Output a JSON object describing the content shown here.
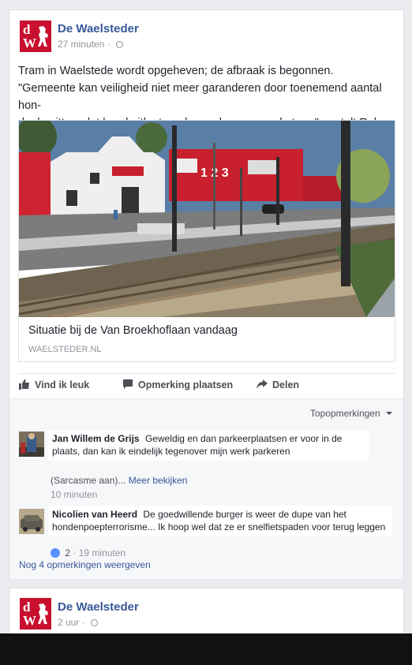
{
  "post": {
    "page_name": "De Waelsteder",
    "time": "27 minuten",
    "text_line1": "Tram in Waelstede wordt opgeheven; de afbraak is begonnen.",
    "text_line2": "\"Gemeente kan veiligheid niet meer garanderen door toenemend aantal hon-",
    "text_line3": "denbezitters dat hond uitlaat op de grasbanen van de tram\", vertelt Rob.",
    "link_title": "Situatie bij de Van Broekhoflaan vandaag",
    "link_domain": "WAELSTEDER.NL",
    "building_sign": "1 2 3"
  },
  "logo": {
    "line1": "d",
    "line2": "W"
  },
  "actions": {
    "like": "Vind ik leuk",
    "comment": "Opmerking plaatsen",
    "share": "Delen"
  },
  "comments": {
    "sort_label": "Topopmerkingen",
    "items": [
      {
        "author": "Jan Willem de Grijs",
        "text_a": "Geweldig en dan parkeerplaatsen er voor in de",
        "text_b": "plaats, dan kan ik eindelijk tegenover mijn werk parkeren",
        "extra": "(Sarcasme aan)...",
        "see_more": "Meer bekijken",
        "time": "10 minuten"
      },
      {
        "author": "Nicolien van Heerd",
        "text_a": "De goedwillende burger is weer de dupe van het",
        "text_b": "hondenpoepterrorisme... Ik hoop wel dat ze er snelfietspaden voor",
        "text_c": "terug leggen",
        "likes": "2",
        "time": "19 minuten"
      }
    ],
    "more": "Nog 4 opmerkingen weergeven"
  },
  "post2": {
    "page_name": "De Waelsteder",
    "time": "2 uur"
  },
  "colors": {
    "brand_red": "#c8102e",
    "link_blue": "#365899",
    "background": "#e9ebee"
  }
}
